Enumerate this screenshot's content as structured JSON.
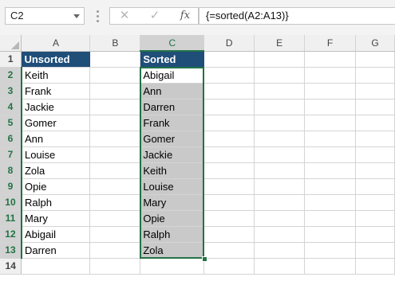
{
  "formula_bar": {
    "name_box": "C2",
    "cancel_icon": "✕",
    "enter_icon": "✓",
    "fx_label": "fx",
    "formula": "{=sorted(A2:A13)}"
  },
  "columns": [
    "A",
    "B",
    "C",
    "D",
    "E",
    "F",
    "G"
  ],
  "rows": [
    "1",
    "2",
    "3",
    "4",
    "5",
    "6",
    "7",
    "8",
    "9",
    "10",
    "11",
    "12",
    "13",
    "14"
  ],
  "headers": {
    "a1": "Unsorted",
    "c1": "Sorted"
  },
  "unsorted": [
    "Keith",
    "Frank",
    "Jackie",
    "Gomer",
    "Ann",
    "Louise",
    "Zola",
    "Opie",
    "Ralph",
    "Mary",
    "Abigail",
    "Darren"
  ],
  "sorted": [
    "Abigail",
    "Ann",
    "Darren",
    "Frank",
    "Gomer",
    "Jackie",
    "Keith",
    "Louise",
    "Mary",
    "Opie",
    "Ralph",
    "Zola"
  ],
  "colors": {
    "header_fill": "#1f4e79",
    "selection": "#217346",
    "highlight": "#c9c9c9"
  }
}
